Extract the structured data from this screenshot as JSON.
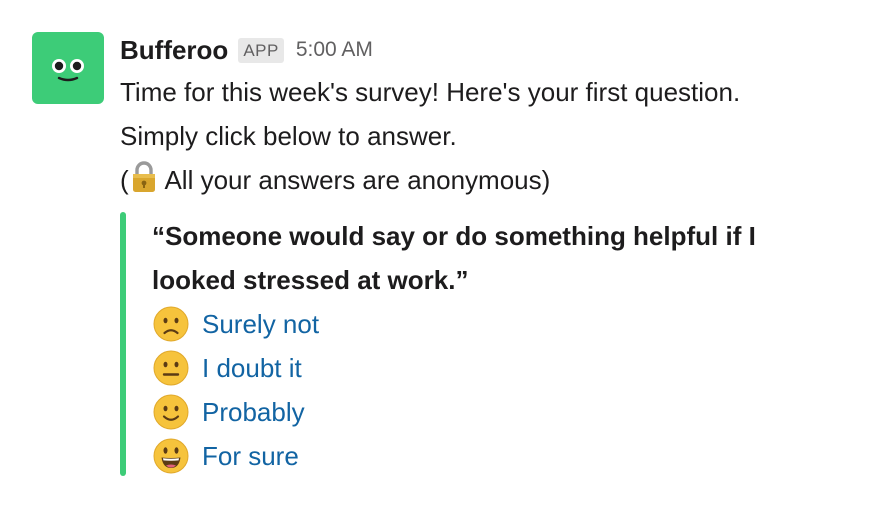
{
  "message": {
    "sender": "Bufferoo",
    "badge": "APP",
    "timestamp": "5:00 AM",
    "line1": "Time for this week's survey! Here's your first question.",
    "line2": "Simply click below to answer.",
    "line3_open": "(",
    "line3_text": " All your answers are anonymous)"
  },
  "survey": {
    "question_line1": "“Someone would say or do something helpful if I",
    "question_line2": "looked stressed at work.”",
    "options": [
      {
        "label": "Surely not",
        "icon": "slightly-frowning-face-icon"
      },
      {
        "label": "I doubt it",
        "icon": "neutral-face-icon"
      },
      {
        "label": "Probably",
        "icon": "slightly-smiling-face-icon"
      },
      {
        "label": "For sure",
        "icon": "grinning-face-icon"
      }
    ]
  },
  "colors": {
    "accent": "#3dcc78",
    "link": "#1264a3",
    "text": "#1d1c1d",
    "muted": "#616061"
  }
}
